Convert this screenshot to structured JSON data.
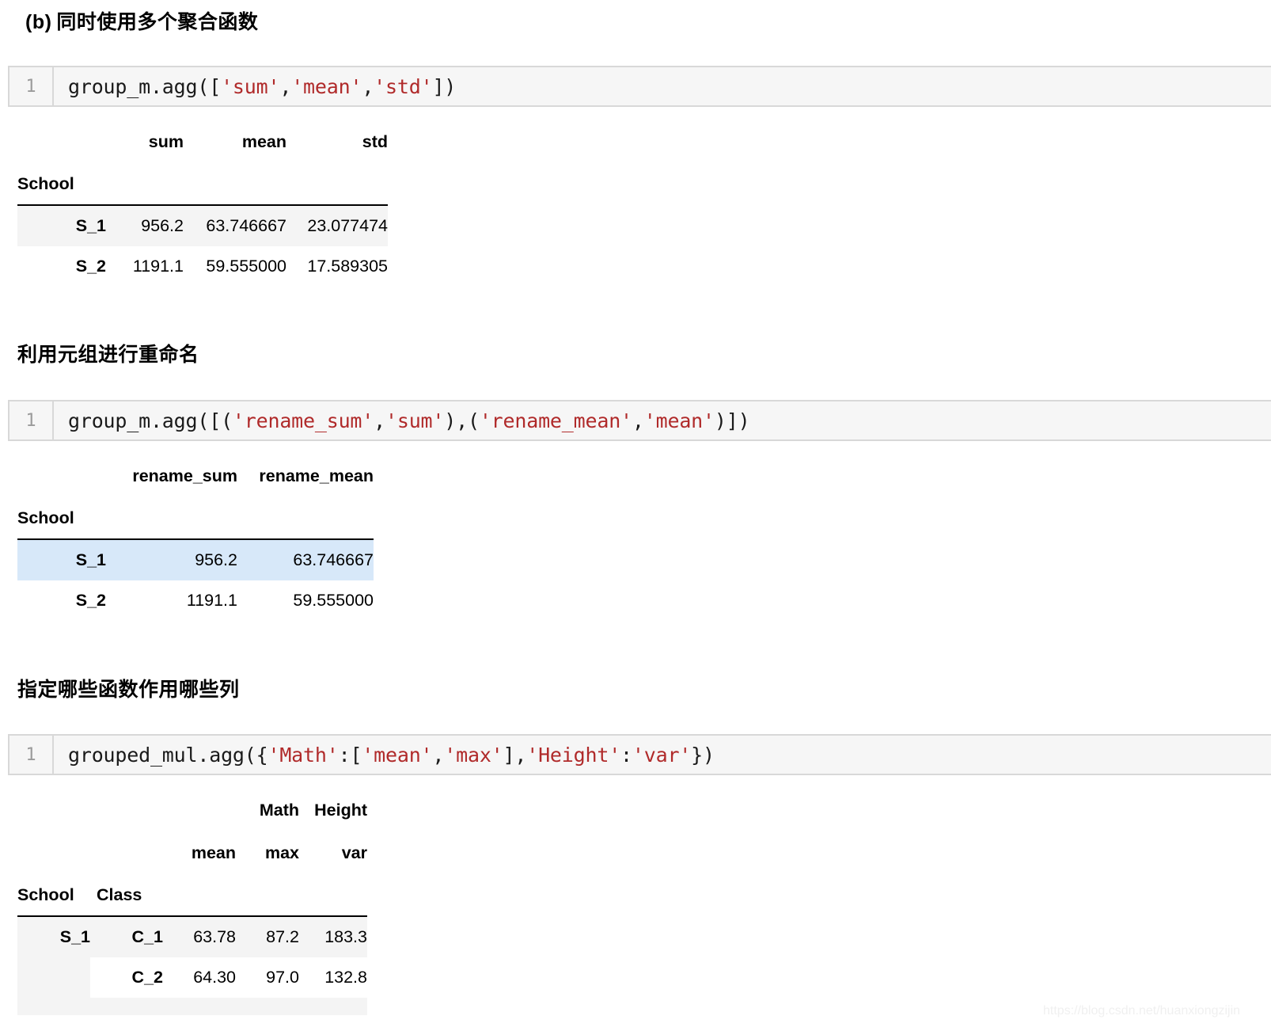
{
  "sections": [
    {
      "heading_prefix": "(b)",
      "heading": "同时使用多个聚合函数",
      "code": {
        "line_number": "1",
        "text": "group_m.agg(['sum','mean','std'])",
        "tokens": [
          {
            "t": "group_m.agg([",
            "c": "plain"
          },
          {
            "t": "'sum'",
            "c": "str"
          },
          {
            "t": ",",
            "c": "plain"
          },
          {
            "t": "'mean'",
            "c": "str"
          },
          {
            "t": ",",
            "c": "plain"
          },
          {
            "t": "'std'",
            "c": "str"
          },
          {
            "t": "])",
            "c": "plain"
          }
        ]
      },
      "table": {
        "columns": [
          "sum",
          "mean",
          "std"
        ],
        "index_name": "School",
        "rows": [
          {
            "index": "S_1",
            "values": [
              "956.2",
              "63.746667",
              "23.077474"
            ],
            "style": "zebra"
          },
          {
            "index": "S_2",
            "values": [
              "1191.1",
              "59.555000",
              "17.589305"
            ],
            "style": "white"
          }
        ]
      }
    },
    {
      "heading_prefix": "",
      "heading": "利用元组进行重命名",
      "code": {
        "line_number": "1",
        "text": "group_m.agg([('rename_sum','sum'),('rename_mean','mean')])",
        "tokens": [
          {
            "t": "group_m.agg([(",
            "c": "plain"
          },
          {
            "t": "'rename_sum'",
            "c": "str"
          },
          {
            "t": ",",
            "c": "plain"
          },
          {
            "t": "'sum'",
            "c": "str"
          },
          {
            "t": "),(",
            "c": "plain"
          },
          {
            "t": "'rename_mean'",
            "c": "str"
          },
          {
            "t": ",",
            "c": "plain"
          },
          {
            "t": "'mean'",
            "c": "str"
          },
          {
            "t": ")])",
            "c": "plain"
          }
        ]
      },
      "table": {
        "columns": [
          "rename_sum",
          "rename_mean"
        ],
        "index_name": "School",
        "rows": [
          {
            "index": "S_1",
            "values": [
              "956.2",
              "63.746667"
            ],
            "style": "highlight"
          },
          {
            "index": "S_2",
            "values": [
              "1191.1",
              "59.555000"
            ],
            "style": "white"
          }
        ]
      }
    },
    {
      "heading_prefix": "",
      "heading": "指定哪些函数作用哪些列",
      "code": {
        "line_number": "1",
        "text": "grouped_mul.agg({'Math':['mean','max'],'Height':'var'})",
        "tokens": [
          {
            "t": "grouped_mul.agg({",
            "c": "plain"
          },
          {
            "t": "'Math'",
            "c": "str"
          },
          {
            "t": ":[",
            "c": "plain"
          },
          {
            "t": "'mean'",
            "c": "str"
          },
          {
            "t": ",",
            "c": "plain"
          },
          {
            "t": "'max'",
            "c": "str"
          },
          {
            "t": "],",
            "c": "plain"
          },
          {
            "t": "'Height'",
            "c": "str"
          },
          {
            "t": ":",
            "c": "plain"
          },
          {
            "t": "'var'",
            "c": "str"
          },
          {
            "t": "})",
            "c": "plain"
          }
        ]
      },
      "table": {
        "columns_level1": [
          "",
          "Math",
          "Height"
        ],
        "columns_level2": [
          "mean",
          "max",
          "var"
        ],
        "index_names": [
          "School",
          "Class"
        ],
        "rows": [
          {
            "index_l1": "S_1",
            "index_l2": "C_1",
            "values": [
              "63.78",
              "87.2",
              "183.3"
            ],
            "style": "zebra"
          },
          {
            "index_l1": "",
            "index_l2": "C_2",
            "values": [
              "64.30",
              "97.0",
              "132.8"
            ],
            "style": "white"
          },
          {
            "index_l1": "",
            "index_l2": "",
            "values": [
              "",
              "",
              ""
            ],
            "style": "zebra-clipped"
          }
        ]
      }
    }
  ],
  "watermark": "https://blog.csdn.net/huanxiongzijin",
  "colors": {
    "code_background": "#f6f6f6",
    "code_border": "#d8d8d8",
    "code_string": "#b02a2a",
    "gutter_text": "#9b9b9b",
    "zebra_row": "#f4f4f4",
    "highlight_row": "#d7e8f9",
    "rule": "#000000",
    "watermark": "#f0f0f0"
  }
}
